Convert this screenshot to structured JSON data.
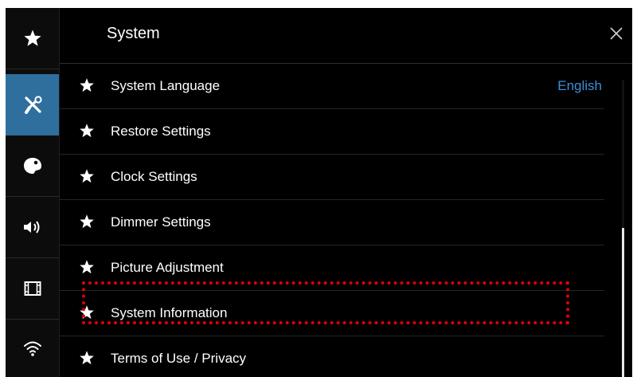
{
  "header": {
    "title": "System",
    "close_icon": "close-icon"
  },
  "sidebar": {
    "items": [
      {
        "name": "favorites",
        "icon": "star-icon",
        "active": false
      },
      {
        "name": "system",
        "icon": "tools-icon",
        "active": true
      },
      {
        "name": "theme",
        "icon": "palette-icon",
        "active": false
      },
      {
        "name": "audio",
        "icon": "speaker-icon",
        "active": false
      },
      {
        "name": "video",
        "icon": "film-icon",
        "active": false
      },
      {
        "name": "wireless",
        "icon": "wifi-icon",
        "active": false
      }
    ]
  },
  "list": {
    "items": [
      {
        "label": "System Language",
        "value": "English",
        "icon": "star-icon"
      },
      {
        "label": "Restore Settings",
        "value": "",
        "icon": "star-icon"
      },
      {
        "label": "Clock Settings",
        "value": "",
        "icon": "star-icon"
      },
      {
        "label": "Dimmer Settings",
        "value": "",
        "icon": "star-icon"
      },
      {
        "label": "Picture Adjustment",
        "value": "",
        "icon": "star-icon"
      },
      {
        "label": "System Information",
        "value": "",
        "icon": "star-icon"
      },
      {
        "label": "Terms of Use / Privacy",
        "value": "",
        "icon": "star-icon"
      }
    ]
  },
  "scrollbar": {
    "position_fraction": 0.5,
    "visible_fraction": 0.5
  },
  "colors": {
    "accent": "#2e6f9e",
    "value_text": "#3d8fd6",
    "highlight": "#e00000"
  }
}
